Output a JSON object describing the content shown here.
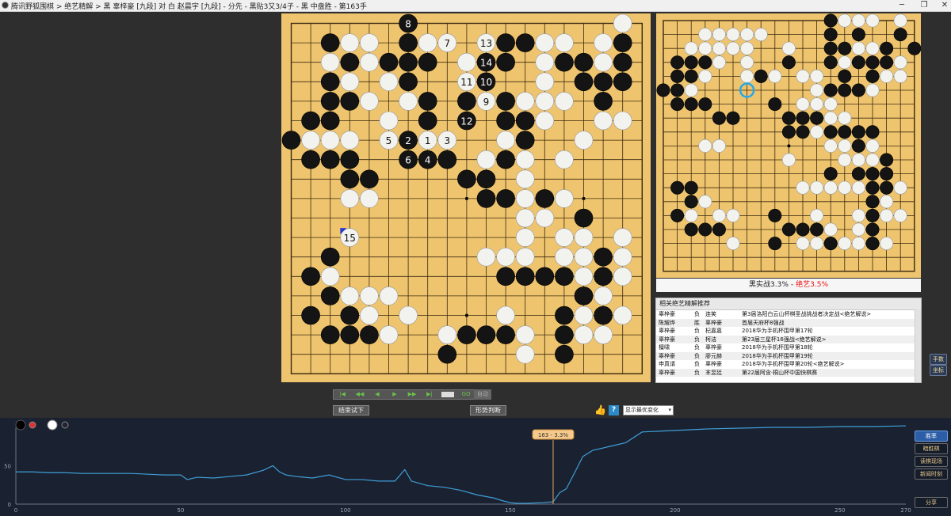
{
  "window": {
    "title": "腾讯野狐围棋 > 绝艺精解 > 黑 辜梓豪 [九段] 对 白 赵晨宇 [九段] - 分先 - 黑贴3又3/4子 - 黑 中盘胜 - 第163手",
    "min_icon": "minimize-icon",
    "max_icon": "maximize-icon",
    "close_icon": "close-icon"
  },
  "main_board": {
    "size": 19,
    "black": [
      [
        6,
        0
      ],
      [
        2,
        1
      ],
      [
        6,
        1
      ],
      [
        11,
        1
      ],
      [
        12,
        1
      ],
      [
        17,
        1
      ],
      [
        19,
        2
      ],
      [
        3,
        2
      ],
      [
        5,
        2
      ],
      [
        6,
        2
      ],
      [
        7,
        2
      ],
      [
        10,
        2
      ],
      [
        11,
        2
      ],
      [
        14,
        2
      ],
      [
        15,
        2
      ],
      [
        17,
        2
      ],
      [
        2,
        3
      ],
      [
        6,
        3
      ],
      [
        10,
        3
      ],
      [
        15,
        3
      ],
      [
        16,
        3
      ],
      [
        17,
        3
      ],
      [
        2,
        4
      ],
      [
        3,
        4
      ],
      [
        7,
        4
      ],
      [
        9,
        4
      ],
      [
        11,
        4
      ],
      [
        16,
        4
      ],
      [
        1,
        5
      ],
      [
        2,
        5
      ],
      [
        7,
        5
      ],
      [
        11,
        5
      ],
      [
        12,
        5
      ],
      [
        0,
        6
      ],
      [
        12,
        6
      ],
      [
        1,
        7
      ],
      [
        2,
        7
      ],
      [
        3,
        7
      ],
      [
        7,
        7
      ],
      [
        8,
        7
      ],
      [
        11,
        7
      ],
      [
        3,
        8
      ],
      [
        4,
        8
      ],
      [
        9,
        8
      ],
      [
        10,
        8
      ],
      [
        10,
        9
      ],
      [
        11,
        9
      ],
      [
        13,
        9
      ],
      [
        15,
        10
      ],
      [
        16,
        12
      ],
      [
        2,
        12
      ],
      [
        1,
        13
      ],
      [
        11,
        13
      ],
      [
        12,
        13
      ],
      [
        13,
        13
      ],
      [
        14,
        13
      ],
      [
        16,
        13
      ],
      [
        2,
        14
      ],
      [
        15,
        14
      ],
      [
        1,
        15
      ],
      [
        3,
        15
      ],
      [
        14,
        15
      ],
      [
        16,
        15
      ],
      [
        2,
        16
      ],
      [
        3,
        16
      ],
      [
        4,
        16
      ],
      [
        9,
        16
      ],
      [
        10,
        16
      ],
      [
        11,
        16
      ],
      [
        14,
        16
      ],
      [
        8,
        17
      ],
      [
        14,
        17
      ]
    ],
    "white": [
      [
        17,
        0
      ],
      [
        3,
        1
      ],
      [
        4,
        1
      ],
      [
        7,
        1
      ],
      [
        13,
        1
      ],
      [
        14,
        1
      ],
      [
        16,
        1
      ],
      [
        2,
        2
      ],
      [
        4,
        2
      ],
      [
        9,
        2
      ],
      [
        13,
        2
      ],
      [
        15,
        2
      ],
      [
        16,
        2
      ],
      [
        3,
        3
      ],
      [
        5,
        3
      ],
      [
        13,
        3
      ],
      [
        4,
        4
      ],
      [
        6,
        4
      ],
      [
        12,
        4
      ],
      [
        13,
        4
      ],
      [
        14,
        4
      ],
      [
        5,
        5
      ],
      [
        13,
        5
      ],
      [
        16,
        5
      ],
      [
        17,
        5
      ],
      [
        1,
        6
      ],
      [
        2,
        6
      ],
      [
        3,
        6
      ],
      [
        11,
        6
      ],
      [
        12,
        6
      ],
      [
        15,
        6
      ],
      [
        10,
        7
      ],
      [
        12,
        7
      ],
      [
        14,
        7
      ],
      [
        12,
        8
      ],
      [
        3,
        9
      ],
      [
        4,
        9
      ],
      [
        12,
        9
      ],
      [
        14,
        9
      ],
      [
        12,
        10
      ],
      [
        13,
        10
      ],
      [
        12,
        11
      ],
      [
        14,
        11
      ],
      [
        15,
        11
      ],
      [
        17,
        11
      ],
      [
        10,
        12
      ],
      [
        11,
        12
      ],
      [
        12,
        12
      ],
      [
        14,
        12
      ],
      [
        15,
        12
      ],
      [
        17,
        12
      ],
      [
        2,
        13
      ],
      [
        15,
        13
      ],
      [
        17,
        13
      ],
      [
        3,
        14
      ],
      [
        4,
        14
      ],
      [
        5,
        14
      ],
      [
        16,
        14
      ],
      [
        4,
        15
      ],
      [
        6,
        15
      ],
      [
        11,
        15
      ],
      [
        15,
        15
      ],
      [
        17,
        15
      ],
      [
        5,
        16
      ],
      [
        8,
        16
      ],
      [
        12,
        16
      ],
      [
        15,
        16
      ],
      [
        16,
        16
      ],
      [
        12,
        17
      ]
    ],
    "numbered": [
      {
        "x": 6,
        "y": 0,
        "label": "8",
        "color": "black"
      },
      {
        "x": 8,
        "y": 1,
        "label": "7",
        "color": "white"
      },
      {
        "x": 10,
        "y": 1,
        "label": "13",
        "color": "white"
      },
      {
        "x": 10,
        "y": 2,
        "label": "14",
        "color": "black"
      },
      {
        "x": 9,
        "y": 3,
        "label": "11",
        "color": "white"
      },
      {
        "x": 10,
        "y": 3,
        "label": "10",
        "color": "black"
      },
      {
        "x": 10,
        "y": 4,
        "label": "9",
        "color": "white"
      },
      {
        "x": 9,
        "y": 5,
        "label": "12",
        "color": "black"
      },
      {
        "x": 5,
        "y": 6,
        "label": "5",
        "color": "white"
      },
      {
        "x": 6,
        "y": 6,
        "label": "2",
        "color": "black"
      },
      {
        "x": 7,
        "y": 6,
        "label": "1",
        "color": "white"
      },
      {
        "x": 8,
        "y": 6,
        "label": "3",
        "color": "white"
      },
      {
        "x": 6,
        "y": 7,
        "label": "6",
        "color": "black"
      },
      {
        "x": 7,
        "y": 7,
        "label": "4",
        "color": "black"
      },
      {
        "x": 3,
        "y": 11,
        "label": "15",
        "color": "white"
      }
    ]
  },
  "mini_board": {
    "size": 19,
    "black": [
      [
        12,
        0
      ],
      [
        12,
        1
      ],
      [
        14,
        1
      ],
      [
        17,
        1
      ],
      [
        18,
        2
      ],
      [
        12,
        2
      ],
      [
        13,
        2
      ],
      [
        16,
        2
      ],
      [
        1,
        3
      ],
      [
        2,
        3
      ],
      [
        3,
        3
      ],
      [
        9,
        3
      ],
      [
        12,
        3
      ],
      [
        14,
        3
      ],
      [
        15,
        3
      ],
      [
        16,
        3
      ],
      [
        1,
        4
      ],
      [
        2,
        4
      ],
      [
        7,
        4
      ],
      [
        13,
        4
      ],
      [
        15,
        4
      ],
      [
        0,
        5
      ],
      [
        1,
        5
      ],
      [
        12,
        5
      ],
      [
        13,
        5
      ],
      [
        14,
        5
      ],
      [
        1,
        6
      ],
      [
        2,
        6
      ],
      [
        3,
        6
      ],
      [
        8,
        6
      ],
      [
        4,
        7
      ],
      [
        5,
        7
      ],
      [
        9,
        7
      ],
      [
        10,
        7
      ],
      [
        11,
        7
      ],
      [
        9,
        8
      ],
      [
        10,
        8
      ],
      [
        12,
        8
      ],
      [
        13,
        8
      ],
      [
        14,
        8
      ],
      [
        15,
        8
      ],
      [
        14,
        9
      ],
      [
        16,
        10
      ],
      [
        12,
        11
      ],
      [
        14,
        11
      ],
      [
        15,
        11
      ],
      [
        16,
        11
      ],
      [
        1,
        12
      ],
      [
        2,
        12
      ],
      [
        15,
        12
      ],
      [
        16,
        12
      ],
      [
        2,
        13
      ],
      [
        15,
        13
      ],
      [
        1,
        14
      ],
      [
        8,
        14
      ],
      [
        15,
        14
      ],
      [
        2,
        15
      ],
      [
        3,
        15
      ],
      [
        4,
        15
      ],
      [
        9,
        15
      ],
      [
        10,
        15
      ],
      [
        11,
        15
      ],
      [
        15,
        15
      ],
      [
        8,
        16
      ],
      [
        12,
        16
      ],
      [
        15,
        16
      ]
    ],
    "white": [
      [
        12,
        0
      ],
      [
        13,
        0
      ],
      [
        14,
        0
      ],
      [
        15,
        0
      ],
      [
        17,
        0
      ],
      [
        3,
        1
      ],
      [
        4,
        1
      ],
      [
        5,
        1
      ],
      [
        6,
        1
      ],
      [
        7,
        1
      ],
      [
        2,
        2
      ],
      [
        3,
        2
      ],
      [
        4,
        2
      ],
      [
        5,
        2
      ],
      [
        6,
        2
      ],
      [
        9,
        2
      ],
      [
        13,
        2
      ],
      [
        14,
        2
      ],
      [
        15,
        2
      ],
      [
        4,
        3
      ],
      [
        6,
        3
      ],
      [
        13,
        3
      ],
      [
        14,
        3
      ],
      [
        17,
        3
      ],
      [
        3,
        4
      ],
      [
        6,
        4
      ],
      [
        8,
        4
      ],
      [
        10,
        4
      ],
      [
        11,
        4
      ],
      [
        16,
        4
      ],
      [
        17,
        4
      ],
      [
        1,
        5
      ],
      [
        2,
        5
      ],
      [
        11,
        5
      ],
      [
        12,
        5
      ],
      [
        15,
        5
      ],
      [
        10,
        6
      ],
      [
        11,
        6
      ],
      [
        12,
        6
      ],
      [
        9,
        7
      ],
      [
        12,
        7
      ],
      [
        13,
        7
      ],
      [
        11,
        8
      ],
      [
        3,
        9
      ],
      [
        4,
        9
      ],
      [
        12,
        9
      ],
      [
        13,
        9
      ],
      [
        15,
        9
      ],
      [
        13,
        10
      ],
      [
        14,
        10
      ],
      [
        15,
        10
      ],
      [
        10,
        12
      ],
      [
        11,
        12
      ],
      [
        12,
        12
      ],
      [
        13,
        12
      ],
      [
        14,
        12
      ],
      [
        17,
        12
      ],
      [
        3,
        13
      ],
      [
        16,
        13
      ],
      [
        2,
        14
      ],
      [
        4,
        14
      ],
      [
        5,
        14
      ],
      [
        16,
        14
      ],
      [
        17,
        14
      ],
      [
        12,
        15
      ],
      [
        14,
        15
      ],
      [
        10,
        16
      ],
      [
        11,
        16
      ],
      [
        13,
        16
      ],
      [
        14,
        16
      ],
      [
        16,
        16
      ],
      [
        5,
        16
      ],
      [
        11,
        14
      ],
      [
        14,
        14
      ],
      [
        9,
        10
      ]
    ],
    "highlight": {
      "x": 6,
      "y": 5
    }
  },
  "score": {
    "black_label": "黑实战3.3%",
    "separator": "-",
    "ai_label": "绝艺3.5%"
  },
  "recommendations": {
    "header": "相关绝艺精解推荐",
    "rows": [
      {
        "player": "辜梓豪",
        "result": "负",
        "opponent": "连笑",
        "event": "第3届洛阳白云山杯棋圣战挑战者决定战<绝艺解说>"
      },
      {
        "player": "陈耀烨",
        "result": "胜",
        "opponent": "辜梓豪",
        "event": "首届天府杯8强战"
      },
      {
        "player": "辜梓豪",
        "result": "负",
        "opponent": "杞嘉嘉",
        "event": "2018华为手机杯围甲第17轮"
      },
      {
        "player": "辜梓豪",
        "result": "负",
        "opponent": "柯洁",
        "event": "第23届三星杯16强战<绝艺解说>"
      },
      {
        "player": "檀啸",
        "result": "负",
        "opponent": "辜梓豪",
        "event": "2018华为手机杯围甲第18轮"
      },
      {
        "player": "辜梓豪",
        "result": "负",
        "opponent": "廖元赫",
        "event": "2018华为手机杯围甲第19轮"
      },
      {
        "player": "申真谞",
        "result": "负",
        "opponent": "辜梓豪",
        "event": "2018华为手机杯围甲第20轮<绝艺解说>"
      },
      {
        "player": "辜梓豪",
        "result": "负",
        "opponent": "芈昱廷",
        "event": "第22届阿含·桐山杯中国快棋赛"
      }
    ]
  },
  "side_buttons": [
    "手数",
    "坐标"
  ],
  "nav": {
    "buttons": [
      "|◀",
      "◀◀",
      "◀",
      "▶",
      "▶▶",
      "▶|"
    ],
    "go_label": "GO",
    "auto_label": "自动",
    "try_label": "结束试下",
    "judge_label": "形势判断",
    "thumb_icon": "thumbs-up-icon",
    "help_label": "?",
    "show_select": "显示最优变化"
  },
  "chart_data": {
    "type": "line",
    "x": [
      0,
      5,
      10,
      15,
      20,
      25,
      30,
      35,
      40,
      45,
      50,
      52,
      55,
      60,
      65,
      70,
      75,
      78,
      80,
      82,
      85,
      90,
      95,
      100,
      105,
      110,
      115,
      118,
      120,
      125,
      130,
      135,
      140,
      145,
      148,
      150,
      152,
      155,
      160,
      163,
      165,
      167,
      170,
      172,
      175,
      180,
      185,
      190,
      195,
      200,
      210,
      220,
      230,
      240,
      250,
      260,
      270
    ],
    "values": [
      42,
      42,
      41,
      41,
      40,
      40,
      40,
      40,
      39,
      38,
      38,
      32,
      35,
      34,
      36,
      38,
      44,
      50,
      42,
      38,
      36,
      34,
      38,
      32,
      32,
      30,
      30,
      45,
      30,
      24,
      22,
      18,
      12,
      8,
      4,
      2,
      1,
      1,
      2,
      3,
      15,
      20,
      45,
      62,
      70,
      75,
      80,
      94,
      95,
      96,
      98,
      99,
      100,
      100,
      101,
      101,
      102
    ],
    "current_label": "163 - 3.3%",
    "current_x": 163,
    "xlim": [
      0,
      270
    ],
    "ylim": [
      0,
      100
    ],
    "x_ticks": [
      0,
      50,
      100,
      150,
      200,
      250,
      270
    ],
    "y_ticks": [
      0,
      50
    ],
    "line_color": "#3f9fd8"
  },
  "chart_buttons": [
    "胜率",
    "暗胜棋",
    "读棋现场",
    "新闻时刻"
  ],
  "share_label": "分享"
}
